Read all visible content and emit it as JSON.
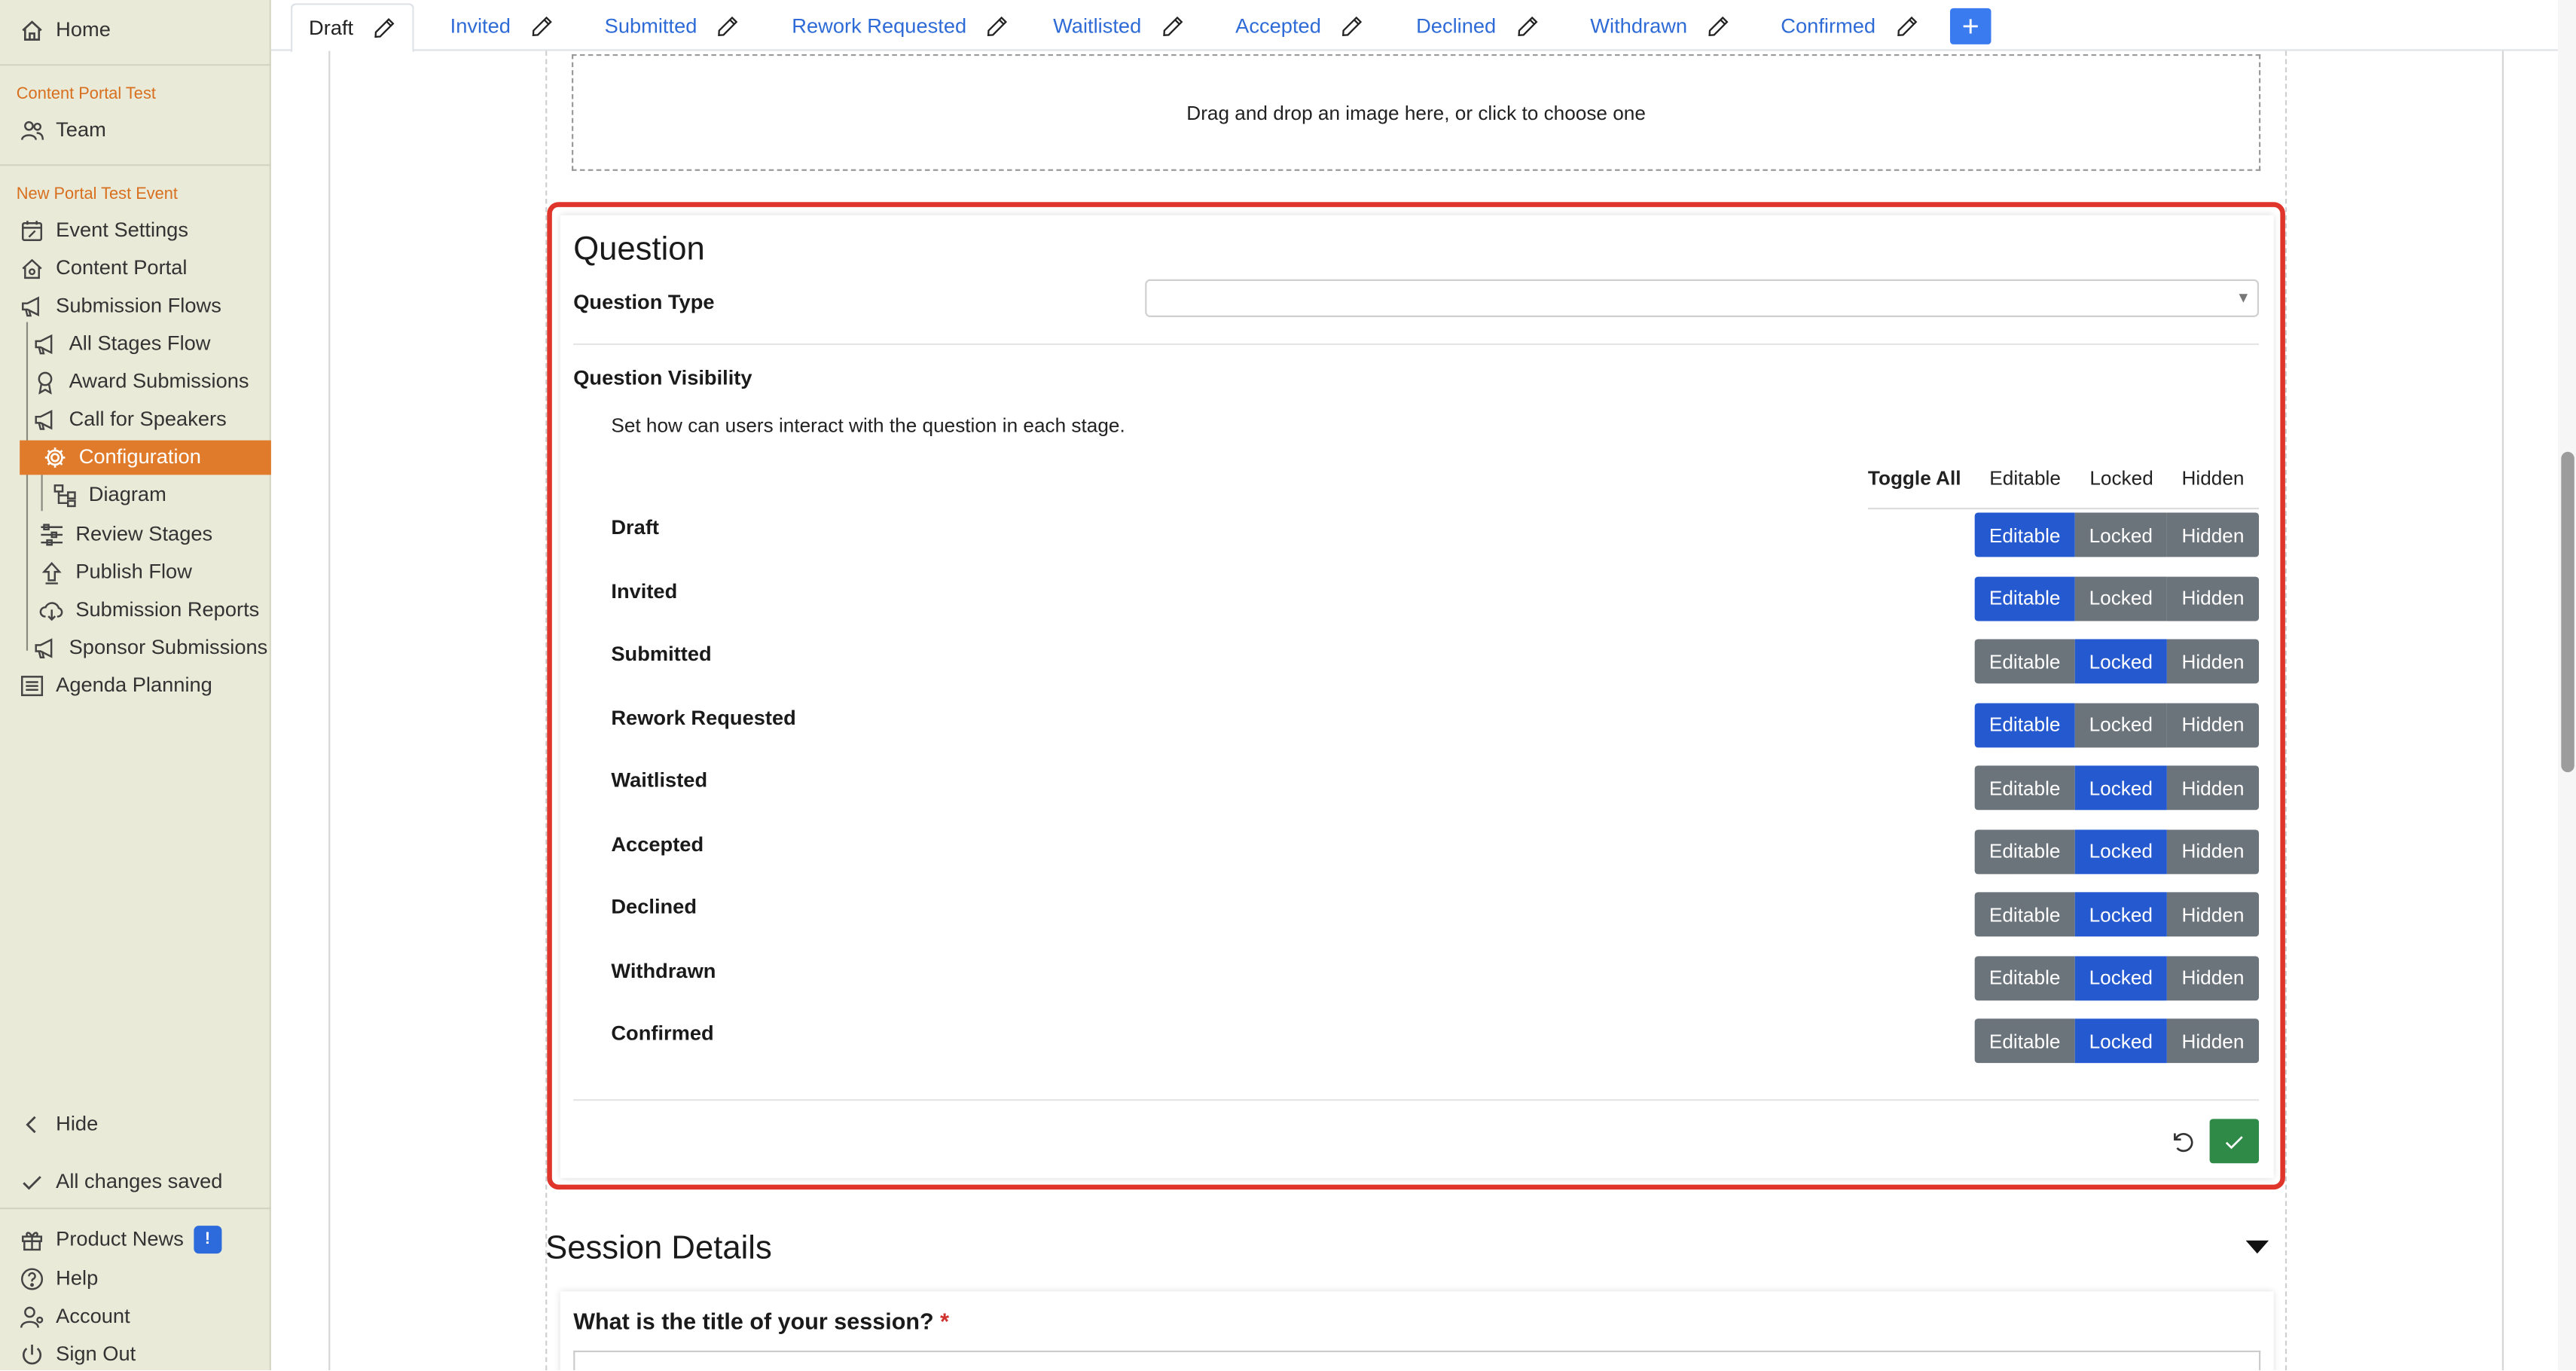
{
  "sidebar": {
    "home": "Home",
    "section_org": "Content Portal Test",
    "team": "Team",
    "section_event": "New Portal Test Event",
    "items": [
      {
        "label": "Event Settings",
        "icon": "calendar-edit-icon"
      },
      {
        "label": "Content Portal",
        "icon": "portal-home-icon"
      },
      {
        "label": "Submission Flows",
        "icon": "megaphone-icon"
      },
      {
        "label": "All Stages Flow",
        "icon": "megaphone-icon"
      },
      {
        "label": "Award Submissions",
        "icon": "award-icon"
      },
      {
        "label": "Call for Speakers",
        "icon": "megaphone-icon"
      },
      {
        "label": "Configuration",
        "icon": "gear-icon",
        "active": true
      },
      {
        "label": "Diagram",
        "icon": "diagram-icon"
      },
      {
        "label": "Review Stages",
        "icon": "review-stages-icon"
      },
      {
        "label": "Publish Flow",
        "icon": "publish-icon"
      },
      {
        "label": "Submission Reports",
        "icon": "download-cloud-icon"
      },
      {
        "label": "Sponsor Submissions",
        "icon": "megaphone-icon"
      },
      {
        "label": "Agenda Planning",
        "icon": "list-icon"
      }
    ],
    "hide": "Hide",
    "saved_status": "All changes saved",
    "product_news": "Product News",
    "product_news_badge": "!",
    "help": "Help",
    "account": "Account",
    "sign_out": "Sign Out",
    "active_color": "#e07b2c",
    "section_color": "#d86f1f"
  },
  "tabs": [
    {
      "label": "Draft",
      "active": true
    },
    {
      "label": "Invited"
    },
    {
      "label": "Submitted"
    },
    {
      "label": "Rework Requested"
    },
    {
      "label": "Waitlisted"
    },
    {
      "label": "Accepted"
    },
    {
      "label": "Declined"
    },
    {
      "label": "Withdrawn"
    },
    {
      "label": "Confirmed"
    }
  ],
  "tab_add_label": "+",
  "dropzone_text": "Drag and drop an image here, or click to choose one",
  "question": {
    "title": "Question",
    "type_label": "Question Type",
    "type_value": "",
    "visibility_label": "Question Visibility",
    "visibility_help": "Set how can users interact with the question in each stage.",
    "toggle_all": "Toggle All",
    "options": [
      "Editable",
      "Locked",
      "Hidden"
    ],
    "stages": [
      {
        "name": "Draft",
        "value": "Editable"
      },
      {
        "name": "Invited",
        "value": "Editable"
      },
      {
        "name": "Submitted",
        "value": "Locked"
      },
      {
        "name": "Rework Requested",
        "value": "Editable"
      },
      {
        "name": "Waitlisted",
        "value": "Locked"
      },
      {
        "name": "Accepted",
        "value": "Locked"
      },
      {
        "name": "Declined",
        "value": "Locked"
      },
      {
        "name": "Withdrawn",
        "value": "Locked"
      },
      {
        "name": "Confirmed",
        "value": "Locked"
      }
    ],
    "highlight_color": "#e0352b",
    "selected_color": "#2559d0",
    "unselected_color": "#6b737b"
  },
  "session_details": {
    "title": "Session Details",
    "first_question": "What is the title of your session?",
    "required_marker": "*"
  }
}
